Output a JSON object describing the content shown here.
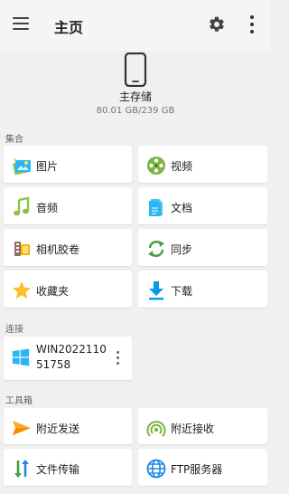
{
  "appbar": {
    "title": "主页"
  },
  "storage": {
    "name": "主存储",
    "size": "80.01 GB/239 GB"
  },
  "sections": {
    "collections": "集合",
    "connections": "连接",
    "toolbox": "工具箱"
  },
  "collections": [
    {
      "label": "图片",
      "icon": "pictures-icon"
    },
    {
      "label": "视频",
      "icon": "video-reel-icon"
    },
    {
      "label": "音频",
      "icon": "music-note-icon"
    },
    {
      "label": "文档",
      "icon": "document-icon"
    },
    {
      "label": "相机胶卷",
      "icon": "camera-roll-icon"
    },
    {
      "label": "同步",
      "icon": "sync-icon"
    },
    {
      "label": "收藏夹",
      "icon": "star-icon"
    },
    {
      "label": "下载",
      "icon": "download-icon"
    }
  ],
  "connection": {
    "label": "WIN202211051758",
    "icon": "windows-icon"
  },
  "toolbox": [
    {
      "label": "附近发送",
      "icon": "send-icon"
    },
    {
      "label": "附近接收",
      "icon": "receive-icon"
    },
    {
      "label": "文件传输",
      "icon": "transfer-icon"
    },
    {
      "label": "FTP服务器",
      "icon": "globe-icon"
    }
  ],
  "colors": {
    "accent": "#4caf50",
    "background": "#f0f0f0"
  }
}
